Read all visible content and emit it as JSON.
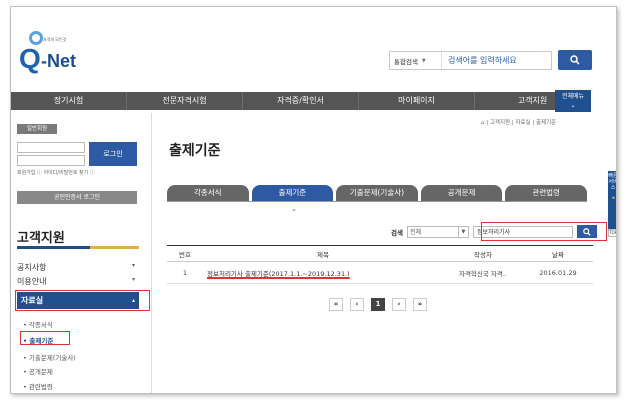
{
  "header": {
    "logo_tagline": "자격의 모든것",
    "logo_q": "Q",
    "logo_net": "-Net",
    "search_select": "통합검색",
    "search_placeholder": "검색어를 입력하세요"
  },
  "gnb": {
    "items": [
      "정기시험",
      "전문자격시험",
      "자격증/확인서",
      "마이페이지",
      "고객지원"
    ],
    "all_menu": "전체메뉴"
  },
  "login": {
    "title": "일반회원",
    "button": "로그인",
    "links": "회원가입 ⓘ 아이디/비밀번호 찾기 ⓘ",
    "cert_button": "공인인증서 로그인"
  },
  "sidebar": {
    "title": "고객지원",
    "menu": [
      "공지사항",
      "이용안내",
      "자료실"
    ],
    "submenu": [
      "• 각종서식",
      "• 출제기준",
      "• 기출문제(기술사)",
      "• 공개문제",
      "• 관련법령"
    ]
  },
  "breadcrumb": "⌂ | 고객지원 | 자료실 | 출제기준",
  "page_title": "출제기준",
  "tabs": [
    "각종서식",
    "출제기준",
    "기출문제(기술사)",
    "공개문제",
    "관련법령"
  ],
  "list_search": {
    "label": "검색",
    "select": "전체",
    "value": "정보처리기사"
  },
  "quick_menu": "빠른서비스",
  "top_label": "TOP",
  "table": {
    "headers": [
      "번호",
      "제목",
      "작성자",
      "날짜"
    ],
    "rows": [
      {
        "no": "1",
        "title": "정보처리기사 출제기준(2017.1.1.~2019.12.31.)",
        "author": "자격혁신국 자격..",
        "date": "2016.01.29"
      }
    ]
  },
  "pager": {
    "first": "«",
    "prev": "‹",
    "current": "1",
    "next": "›",
    "last": "»"
  },
  "colors": {
    "primary": "#2d5aa3",
    "nav": "#555555",
    "highlight": "#dd3333"
  }
}
